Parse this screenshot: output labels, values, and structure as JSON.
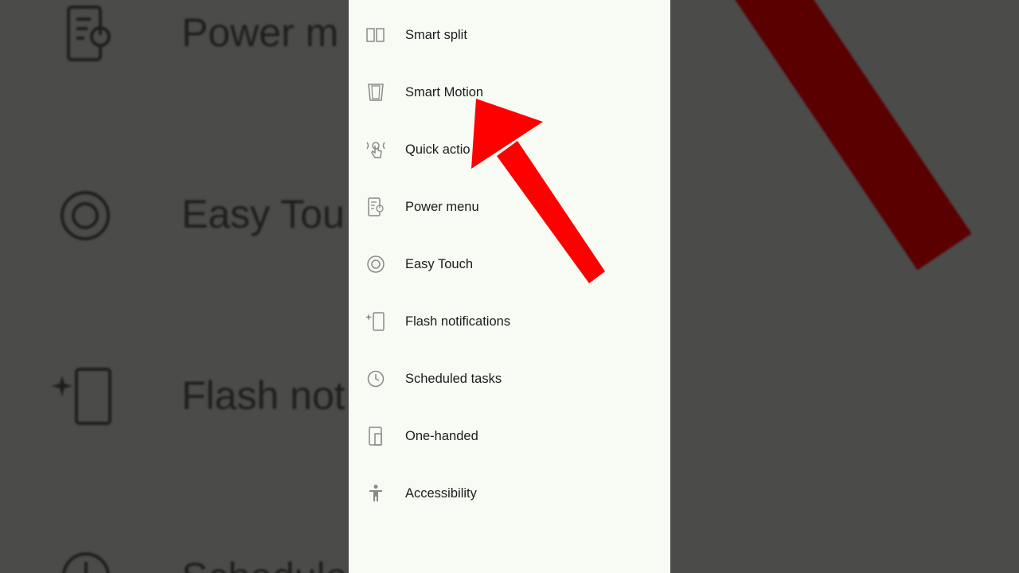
{
  "background": {
    "labels": [
      "Power m",
      "Easy Tou",
      "Flash not",
      "Schedule"
    ],
    "colors": {
      "overlay": "#4b4b4a",
      "bar": "#5a0000"
    }
  },
  "menu": {
    "items": [
      {
        "label": "Smart split",
        "icon": "smart-split-icon"
      },
      {
        "label": "Smart Motion",
        "icon": "smart-motion-icon"
      },
      {
        "label": "Quick actio",
        "icon": "quick-actions-gesture-icon"
      },
      {
        "label": "Power menu",
        "icon": "power-menu-icon"
      },
      {
        "label": "Easy Touch",
        "icon": "easy-touch-icon"
      },
      {
        "label": "Flash notifications",
        "icon": "flash-notifications-icon"
      },
      {
        "label": "Scheduled tasks",
        "icon": "clock-icon"
      },
      {
        "label": "One-handed",
        "icon": "one-handed-icon"
      },
      {
        "label": "Accessibility",
        "icon": "accessibility-icon"
      }
    ]
  },
  "annotation": {
    "arrow_color": "#ff0000",
    "icon_color": "#8a8a8a"
  }
}
